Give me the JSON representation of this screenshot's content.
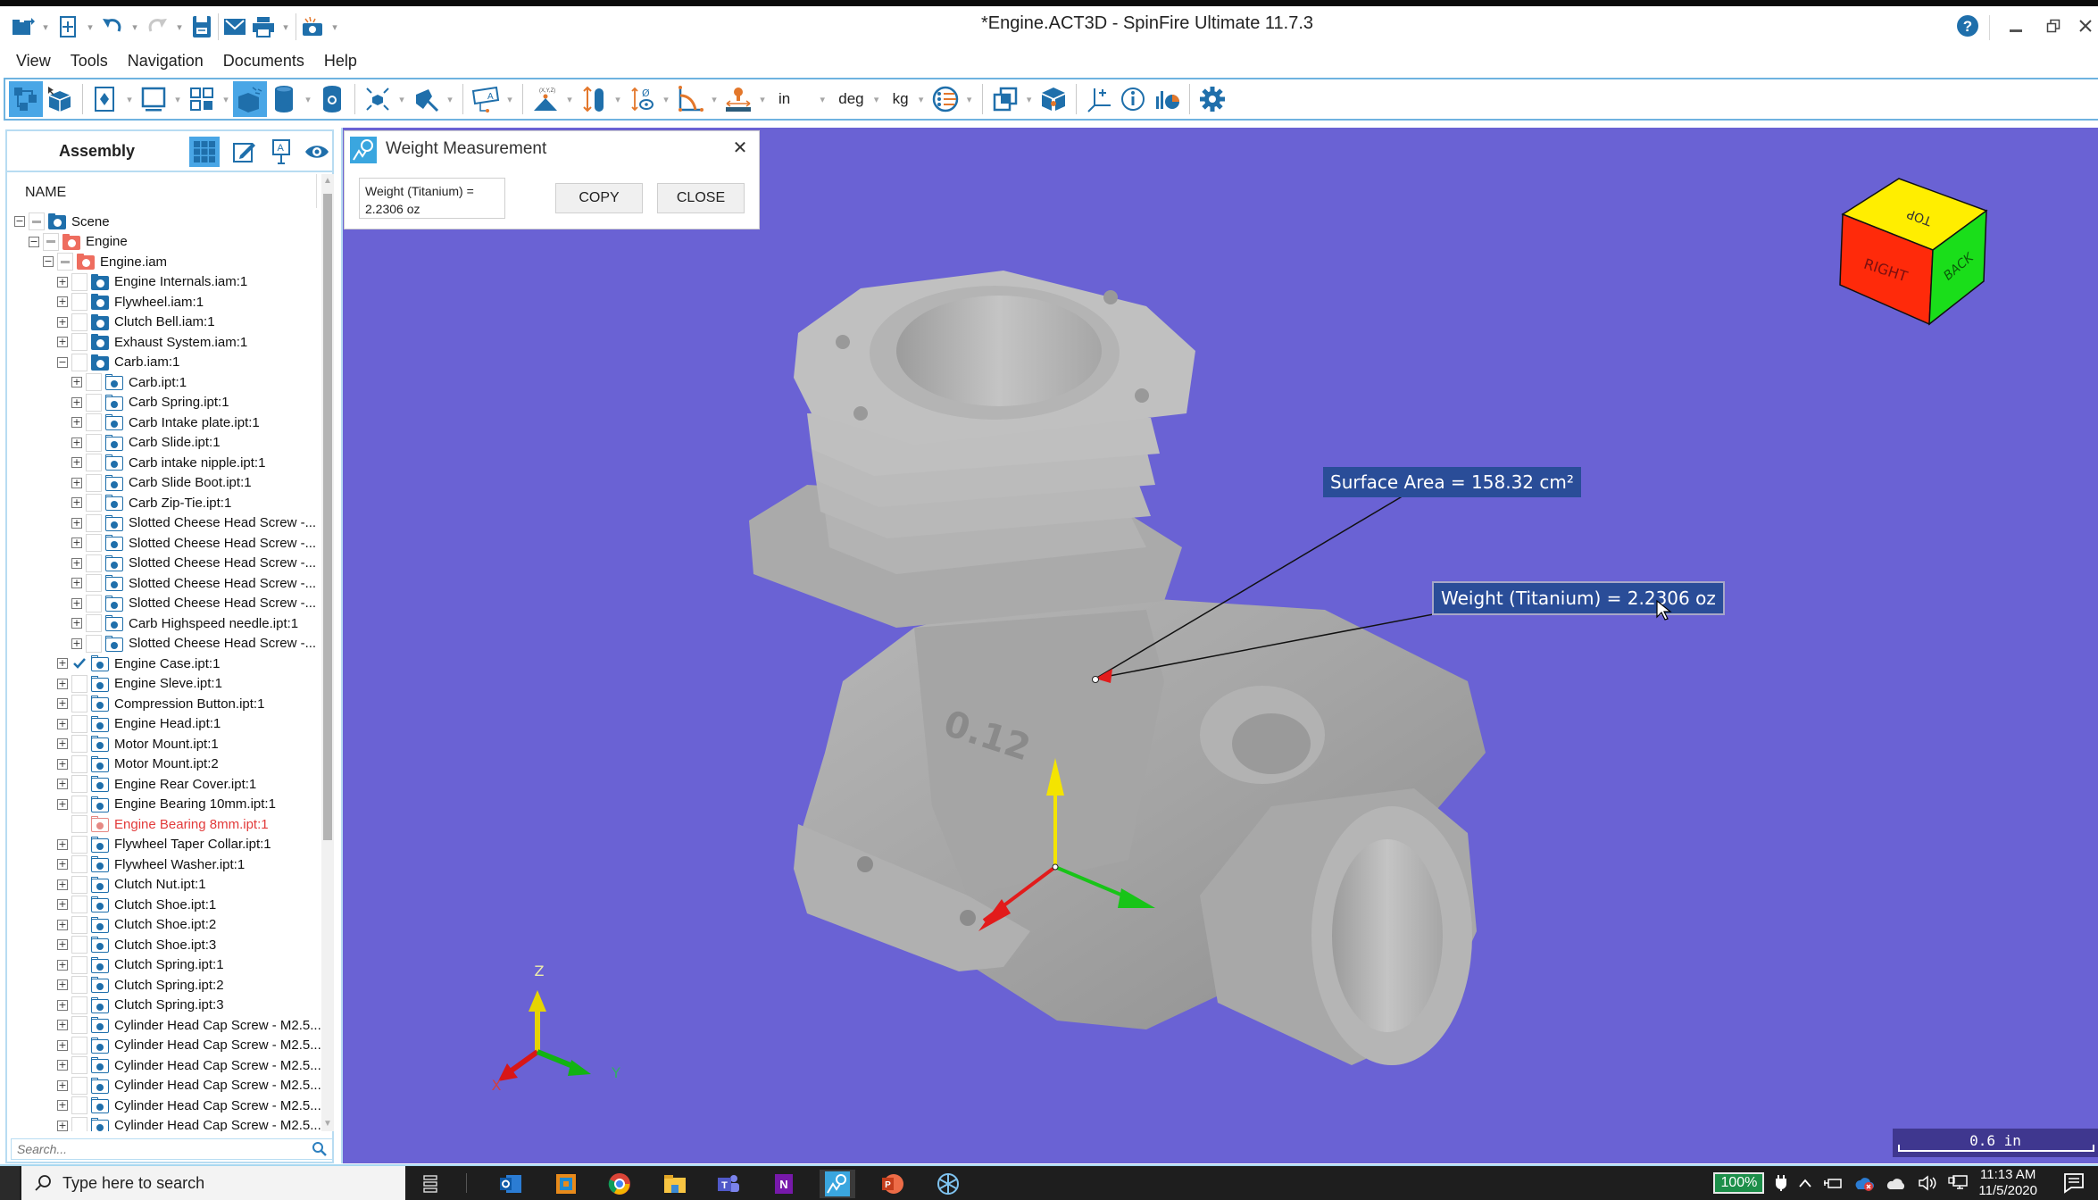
{
  "window": {
    "title": "*Engine.ACT3D - SpinFire Ultimate 11.7.3",
    "help_icon": "question-circle-icon",
    "controls": [
      "minimize",
      "restore",
      "close"
    ]
  },
  "quick_access": [
    {
      "name": "open",
      "icon": "open-folder-icon"
    },
    {
      "name": "new",
      "icon": "new-document-icon"
    },
    {
      "name": "undo",
      "icon": "undo-icon"
    },
    {
      "name": "redo",
      "icon": "redo-icon"
    },
    {
      "name": "save",
      "icon": "save-icon"
    },
    {
      "name": "email",
      "icon": "email-icon"
    },
    {
      "name": "print",
      "icon": "print-icon"
    },
    {
      "name": "screenshot",
      "icon": "camera-icon"
    }
  ],
  "menu": [
    "View",
    "Tools",
    "Navigation",
    "Documents",
    "Help"
  ],
  "toolbar": {
    "units": {
      "length": "in",
      "angle": "deg",
      "mass": "kg"
    },
    "buttons": [
      "assembly-tree",
      "select-part",
      "markup",
      "view-mode",
      "layout",
      "shaded-3d",
      "cylinder",
      "settings-cylinder",
      "explode",
      "section",
      "annotation",
      "point-xyz",
      "measure-height",
      "measure-diameter",
      "measure-angle",
      "measure-distance",
      "display-style",
      "overlay",
      "component-properties",
      "add-axis",
      "info",
      "analysis",
      "options"
    ]
  },
  "assembly_panel": {
    "title": "Assembly",
    "header_icons": [
      "grid-view-icon",
      "edit-note-icon",
      "annotation-icon",
      "visibility-eye-icon"
    ],
    "column_header": "NAME",
    "search_placeholder": "Search...",
    "tree": [
      {
        "label": "Scene",
        "level": 0,
        "expander": "minus",
        "check": "partial",
        "kind": "scene"
      },
      {
        "label": "Engine",
        "level": 1,
        "expander": "minus",
        "check": "partial",
        "kind": "assembly-red"
      },
      {
        "label": "Engine.iam",
        "level": 2,
        "expander": "minus",
        "check": "partial",
        "kind": "assembly-red"
      },
      {
        "label": "Engine Internals.iam:1",
        "level": 3,
        "expander": "plus",
        "check": "none",
        "kind": "assembly"
      },
      {
        "label": "Flywheel.iam:1",
        "level": 3,
        "expander": "plus",
        "check": "none",
        "kind": "assembly"
      },
      {
        "label": "Clutch Bell.iam:1",
        "level": 3,
        "expander": "plus",
        "check": "none",
        "kind": "assembly"
      },
      {
        "label": "Exhaust System.iam:1",
        "level": 3,
        "expander": "plus",
        "check": "none",
        "kind": "assembly"
      },
      {
        "label": "Carb.iam:1",
        "level": 3,
        "expander": "minus",
        "check": "none",
        "kind": "assembly"
      },
      {
        "label": "Carb.ipt:1",
        "level": 4,
        "expander": "plus",
        "check": "none",
        "kind": "part"
      },
      {
        "label": "Carb Spring.ipt:1",
        "level": 4,
        "expander": "plus",
        "check": "none",
        "kind": "part"
      },
      {
        "label": "Carb Intake plate.ipt:1",
        "level": 4,
        "expander": "plus",
        "check": "none",
        "kind": "part"
      },
      {
        "label": "Carb Slide.ipt:1",
        "level": 4,
        "expander": "plus",
        "check": "none",
        "kind": "part"
      },
      {
        "label": "Carb intake nipple.ipt:1",
        "level": 4,
        "expander": "plus",
        "check": "none",
        "kind": "part"
      },
      {
        "label": "Carb Slide Boot.ipt:1",
        "level": 4,
        "expander": "plus",
        "check": "none",
        "kind": "part"
      },
      {
        "label": "Carb Zip-Tie.ipt:1",
        "level": 4,
        "expander": "plus",
        "check": "none",
        "kind": "part"
      },
      {
        "label": "Slotted Cheese Head Screw -...",
        "level": 4,
        "expander": "plus",
        "check": "none",
        "kind": "part"
      },
      {
        "label": "Slotted Cheese Head Screw -...",
        "level": 4,
        "expander": "plus",
        "check": "none",
        "kind": "part"
      },
      {
        "label": "Slotted Cheese Head Screw -...",
        "level": 4,
        "expander": "plus",
        "check": "none",
        "kind": "part"
      },
      {
        "label": "Slotted Cheese Head Screw -...",
        "level": 4,
        "expander": "plus",
        "check": "none",
        "kind": "part"
      },
      {
        "label": "Slotted Cheese Head Screw -...",
        "level": 4,
        "expander": "plus",
        "check": "none",
        "kind": "part"
      },
      {
        "label": "Carb Highspeed needle.ipt:1",
        "level": 4,
        "expander": "plus",
        "check": "none",
        "kind": "part"
      },
      {
        "label": "Slotted Cheese Head Screw -...",
        "level": 4,
        "expander": "plus",
        "check": "none",
        "kind": "part"
      },
      {
        "label": "Engine Case.ipt:1",
        "level": 3,
        "expander": "plus",
        "check": "checked",
        "kind": "part"
      },
      {
        "label": "Engine Sleve.ipt:1",
        "level": 3,
        "expander": "plus",
        "check": "none",
        "kind": "part"
      },
      {
        "label": "Compression Button.ipt:1",
        "level": 3,
        "expander": "plus",
        "check": "none",
        "kind": "part"
      },
      {
        "label": "Engine Head.ipt:1",
        "level": 3,
        "expander": "plus",
        "check": "none",
        "kind": "part"
      },
      {
        "label": "Motor Mount.ipt:1",
        "level": 3,
        "expander": "plus",
        "check": "none",
        "kind": "part"
      },
      {
        "label": "Motor Mount.ipt:2",
        "level": 3,
        "expander": "plus",
        "check": "none",
        "kind": "part"
      },
      {
        "label": "Engine Rear Cover.ipt:1",
        "level": 3,
        "expander": "plus",
        "check": "none",
        "kind": "part"
      },
      {
        "label": "Engine Bearing 10mm.ipt:1",
        "level": 3,
        "expander": "plus",
        "check": "none",
        "kind": "part"
      },
      {
        "label": "Engine Bearing 8mm.ipt:1",
        "level": 3,
        "expander": "none",
        "check": "none",
        "kind": "part-error"
      },
      {
        "label": "Flywheel Taper Collar.ipt:1",
        "level": 3,
        "expander": "plus",
        "check": "none",
        "kind": "part"
      },
      {
        "label": "Flywheel Washer.ipt:1",
        "level": 3,
        "expander": "plus",
        "check": "none",
        "kind": "part"
      },
      {
        "label": "Clutch Nut.ipt:1",
        "level": 3,
        "expander": "plus",
        "check": "none",
        "kind": "part"
      },
      {
        "label": "Clutch Shoe.ipt:1",
        "level": 3,
        "expander": "plus",
        "check": "none",
        "kind": "part"
      },
      {
        "label": "Clutch Shoe.ipt:2",
        "level": 3,
        "expander": "plus",
        "check": "none",
        "kind": "part"
      },
      {
        "label": "Clutch Shoe.ipt:3",
        "level": 3,
        "expander": "plus",
        "check": "none",
        "kind": "part"
      },
      {
        "label": "Clutch Spring.ipt:1",
        "level": 3,
        "expander": "plus",
        "check": "none",
        "kind": "part"
      },
      {
        "label": "Clutch Spring.ipt:2",
        "level": 3,
        "expander": "plus",
        "check": "none",
        "kind": "part"
      },
      {
        "label": "Clutch Spring.ipt:3",
        "level": 3,
        "expander": "plus",
        "check": "none",
        "kind": "part"
      },
      {
        "label": "Cylinder Head Cap Screw - M2.5...",
        "level": 3,
        "expander": "plus",
        "check": "none",
        "kind": "part"
      },
      {
        "label": "Cylinder Head Cap Screw - M2.5...",
        "level": 3,
        "expander": "plus",
        "check": "none",
        "kind": "part"
      },
      {
        "label": "Cylinder Head Cap Screw - M2.5...",
        "level": 3,
        "expander": "plus",
        "check": "none",
        "kind": "part"
      },
      {
        "label": "Cylinder Head Cap Screw - M2.5...",
        "level": 3,
        "expander": "plus",
        "check": "none",
        "kind": "part"
      },
      {
        "label": "Cylinder Head Cap Screw - M2.5...",
        "level": 3,
        "expander": "plus",
        "check": "none",
        "kind": "part"
      },
      {
        "label": "Cylinder Head Cap Screw - M2.5...",
        "level": 3,
        "expander": "plus",
        "check": "none",
        "kind": "part"
      }
    ]
  },
  "weight_dialog": {
    "title": "Weight Measurement",
    "value_text": "Weight (Titanium) = 2.2306 oz",
    "copy_label": "COPY",
    "close_label": "CLOSE"
  },
  "viewport": {
    "background": "#6a62d4",
    "callouts": {
      "surface_area": "Surface Area = 158.32 cm²",
      "weight": "Weight (Titanium) = 2.2306 oz"
    },
    "part_engraving": "0.12",
    "view_cube": {
      "top": "TOP",
      "right": "RIGHT",
      "back": "BACK"
    },
    "axis_labels": {
      "x": "X",
      "y": "Y",
      "z": "Z"
    },
    "scale_bar": "0.6 in"
  },
  "taskbar": {
    "search_placeholder": "Type here to search",
    "apps": [
      "task-view",
      "outlook",
      "spinfire-file",
      "chrome",
      "file-explorer",
      "teams",
      "onenote",
      "spinfire",
      "powerpoint",
      "snowflake-app"
    ],
    "battery": "100%",
    "time": "11:13 AM",
    "date": "11/5/2020"
  }
}
